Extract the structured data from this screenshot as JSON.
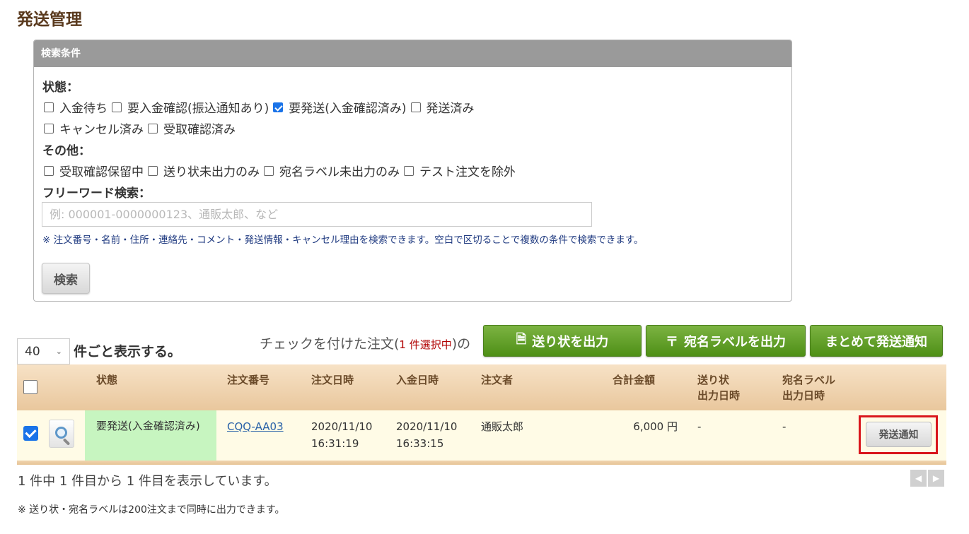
{
  "page": {
    "title": "発送管理"
  },
  "search": {
    "panel_title": "検索条件",
    "status_label": "状態：",
    "status_options": [
      {
        "label": "入金待ち",
        "checked": false
      },
      {
        "label": "要入金確認(振込通知あり)",
        "checked": false
      },
      {
        "label": "要発送(入金確認済み)",
        "checked": true
      },
      {
        "label": "発送済み",
        "checked": false
      },
      {
        "label": "キャンセル済み",
        "checked": false
      },
      {
        "label": "受取確認済み",
        "checked": false
      }
    ],
    "other_label": "その他：",
    "other_options": [
      {
        "label": "受取確認保留中",
        "checked": false
      },
      {
        "label": "送り状未出力のみ",
        "checked": false
      },
      {
        "label": "宛名ラベル未出力のみ",
        "checked": false
      },
      {
        "label": "テスト注文を除外",
        "checked": false
      }
    ],
    "freeword_label": "フリーワード検索：",
    "freeword_value": "",
    "freeword_placeholder": "例: 000001-0000000123、通販太郎、など",
    "hint": "※ 注文番号・名前・住所・連絡先・コメント・発送情報・キャンセル理由を検索できます。空白で区切ることで複数の条件で検索できます。",
    "search_button": "検索"
  },
  "list_controls": {
    "per_page_value": "40",
    "per_page_suffix": "件ごと表示する。",
    "checked_prefix": "チェックを付けた注文(",
    "selected_count_text": "1 件選択中",
    "checked_suffix": ")の",
    "btn_invoice": "送り状を出力",
    "btn_label": "宛名ラベルを出力",
    "btn_bulk_notify": "まとめて発送通知"
  },
  "table": {
    "headers": {
      "status": "状態",
      "order_no": "注文番号",
      "order_date": "注文日時",
      "paid_date": "入金日時",
      "customer": "注文者",
      "total": "合計金額",
      "invoice_line1": "送り状",
      "invoice_line2": "出力日時",
      "label_line1": "宛名ラベル",
      "label_line2": "出力日時"
    },
    "rows": [
      {
        "checked": true,
        "status": "要発送(入金確認済み)",
        "order_no": "CQQ-AA03",
        "order_date": "2020/11/10",
        "order_time": "16:31:19",
        "paid_date": "2020/11/10",
        "paid_time": "16:33:15",
        "customer": "通販太郎",
        "total": "6,000 円",
        "invoice_printed": "-",
        "label_printed": "-",
        "action": "発送通知"
      }
    ]
  },
  "summary": "1 件中 1 件目から 1 件目を表示しています。",
  "pager": {
    "prev": "◀",
    "next": "▶"
  },
  "footnote": "※ 送り状・宛名ラベルは200注文まで同時に出力できます。",
  "colors": {
    "accent_green": "#5a9e22",
    "title_brown": "#5a3a1e",
    "status_green": "#c7f5c0",
    "highlight_red": "#d9161c"
  }
}
